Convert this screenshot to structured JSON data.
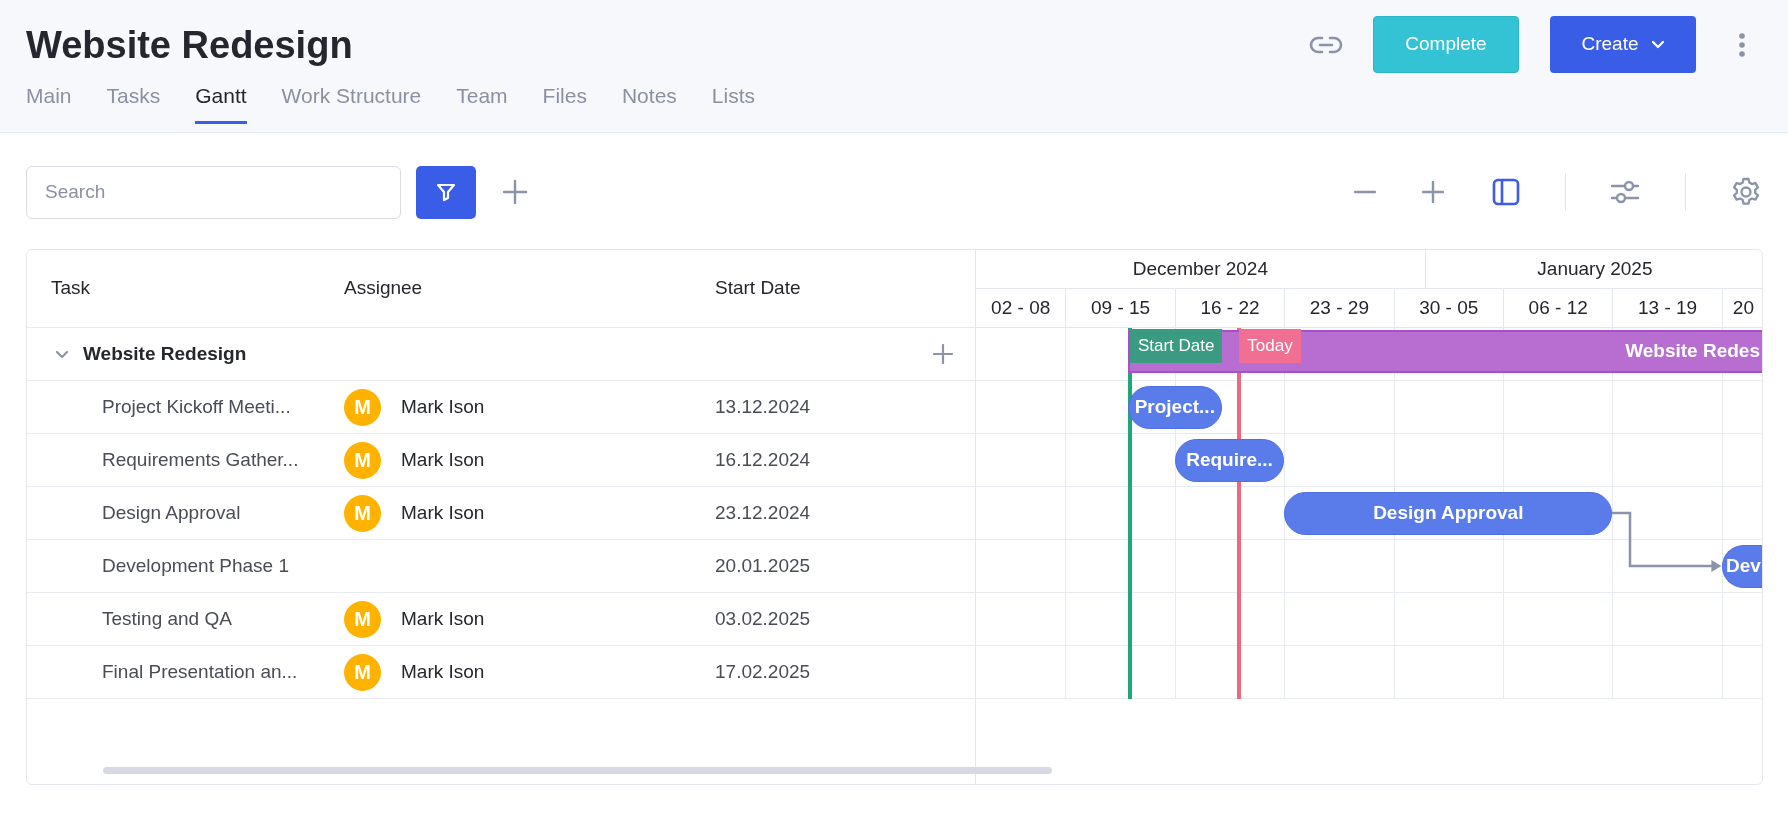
{
  "project": {
    "title": "Website Redesign"
  },
  "actions": {
    "complete": "Complete",
    "create": "Create"
  },
  "tabs": [
    {
      "label": "Main",
      "selected": false
    },
    {
      "label": "Tasks",
      "selected": false
    },
    {
      "label": "Gantt",
      "selected": true
    },
    {
      "label": "Work Structure",
      "selected": false
    },
    {
      "label": "Team",
      "selected": false
    },
    {
      "label": "Files",
      "selected": false
    },
    {
      "label": "Notes",
      "selected": false
    },
    {
      "label": "Lists",
      "selected": false
    }
  ],
  "toolbar": {
    "search": {
      "placeholder": "Search"
    }
  },
  "table": {
    "columns": [
      "Task",
      "Assignee",
      "Start Date"
    ],
    "group": {
      "title": "Website Redesign",
      "expanded": true,
      "bar": {
        "label": "Website Redes"
      },
      "tasks": [
        {
          "name": "Project Kickoff Meeti...",
          "assignee": {
            "initial": "M",
            "name": "Mark Ison"
          },
          "start_date": "13.12.2024",
          "bar": {
            "label": "Project..."
          }
        },
        {
          "name": "Requirements Gather...",
          "assignee": {
            "initial": "M",
            "name": "Mark Ison"
          },
          "start_date": "16.12.2024",
          "bar": {
            "label": "Require..."
          }
        },
        {
          "name": "Design Approval",
          "assignee": {
            "initial": "M",
            "name": "Mark Ison"
          },
          "start_date": "23.12.2024",
          "bar": {
            "label": "Design Approval",
            "arrow_to_next": true
          }
        },
        {
          "name": "Development Phase 1",
          "start_date": "20.01.2025",
          "bar": {
            "label": "Dev"
          }
        },
        {
          "name": "Testing and QA",
          "assignee": {
            "initial": "M",
            "name": "Mark Ison"
          },
          "start_date": "03.02.2025"
        },
        {
          "name": "Final Presentation an...",
          "assignee": {
            "initial": "M",
            "name": "Mark Ison"
          },
          "start_date": "17.02.2025"
        }
      ]
    }
  },
  "timeline": {
    "months": [
      "December 2024",
      "January 2025"
    ],
    "weeks": [
      "02 - 08",
      "09 - 15",
      "16 - 22",
      "23 - 29",
      "30 - 05",
      "06 - 12",
      "13 - 19",
      "20"
    ]
  },
  "markers": [
    {
      "kind": "start",
      "label": "Start Date"
    },
    {
      "kind": "today",
      "label": "Today"
    }
  ]
}
